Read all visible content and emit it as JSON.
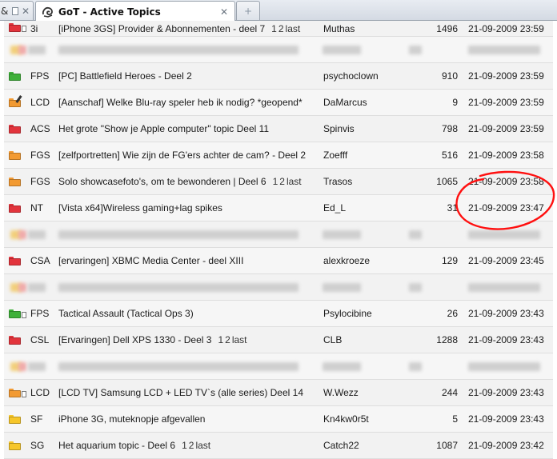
{
  "tabs": {
    "previous": {
      "label": "& "
    },
    "active": {
      "title": "GoT - Active Topics"
    },
    "new_tab_symbol": "+",
    "close_symbol": "✕"
  },
  "colors": {
    "folder_red": "#e2343c",
    "folder_green": "#3fb03a",
    "folder_orange": "#f29a32",
    "folder_yellow": "#f6c62a",
    "annotation_red": "#ff1010"
  },
  "topics": [
    {
      "kind": "topic",
      "icon": "red-folder-doc-icon",
      "color": "red",
      "doc": true,
      "category": "3i",
      "title": "[iPhone 3GS] Provider & Abonnementen - deel 7",
      "pages": [
        "1",
        "2",
        "last"
      ],
      "user": "Muthas",
      "replies": "1496",
      "date": "21-09-2009 23:59"
    },
    {
      "kind": "blurred"
    },
    {
      "kind": "topic",
      "icon": "green-folder-icon",
      "color": "green",
      "category": "FPS",
      "title": "[PC] Battlefield Heroes - Deel 2",
      "pages": [],
      "user": "psychoclown",
      "replies": "910",
      "date": "21-09-2009 23:59"
    },
    {
      "kind": "topic",
      "icon": "orange-folder-pencil-icon",
      "color": "orange",
      "pen": true,
      "category": "LCD",
      "title": "[Aanschaf] Welke Blu-ray speler heb ik nodig? *geopend*",
      "pages": [],
      "user": "DaMarcus",
      "replies": "9",
      "date": "21-09-2009 23:59"
    },
    {
      "kind": "topic",
      "icon": "red-folder-icon",
      "color": "red",
      "category": "ACS",
      "title": "Het grote \"Show je Apple computer\" topic Deel 11",
      "pages": [],
      "user": "Spinvis",
      "replies": "798",
      "date": "21-09-2009 23:59"
    },
    {
      "kind": "topic",
      "icon": "orange-folder-icon",
      "color": "orange",
      "category": "FGS",
      "title": "[zelfportretten] Wie zijn de FG'ers achter de cam? - Deel 2",
      "pages": [],
      "user": "Zoefff",
      "replies": "516",
      "date": "21-09-2009 23:58"
    },
    {
      "kind": "topic",
      "icon": "orange-folder-icon",
      "color": "orange",
      "category": "FGS",
      "title": "Solo showcasefoto's, om te bewonderen | Deel 6",
      "pages": [
        "1",
        "2",
        "last"
      ],
      "user": "Trasos",
      "replies": "1065",
      "date": "21-09-2009 23:58"
    },
    {
      "kind": "topic",
      "icon": "red-folder-icon",
      "color": "red",
      "category": "NT",
      "title": "[Vista x64]Wireless gaming+lag spikes",
      "pages": [],
      "user": "Ed_L",
      "replies": "31",
      "date": "21-09-2009 23:47"
    },
    {
      "kind": "blurred"
    },
    {
      "kind": "topic",
      "icon": "red-folder-icon",
      "color": "red",
      "category": "CSA",
      "title": "[ervaringen] XBMC Media Center - deel XIII",
      "pages": [],
      "user": "alexkroeze",
      "replies": "129",
      "date": "21-09-2009 23:45"
    },
    {
      "kind": "blurred"
    },
    {
      "kind": "topic",
      "icon": "green-folder-doc-icon",
      "color": "green",
      "doc": true,
      "category": "FPS",
      "title": "Tactical Assault (Tactical Ops 3)",
      "pages": [],
      "user": "Psylocibine",
      "replies": "26",
      "date": "21-09-2009 23:43"
    },
    {
      "kind": "topic",
      "icon": "red-folder-icon",
      "color": "red",
      "category": "CSL",
      "title": "[Ervaringen] Dell XPS 1330 - Deel 3",
      "pages": [
        "1",
        "2",
        "last"
      ],
      "user": "CLB",
      "replies": "1288",
      "date": "21-09-2009 23:43"
    },
    {
      "kind": "blurred"
    },
    {
      "kind": "topic",
      "icon": "orange-folder-doc-icon",
      "color": "orange",
      "doc": true,
      "category": "LCD",
      "title": "[LCD TV] Samsung LCD + LED TV`s (alle series) Deel 14",
      "pages": [],
      "user": "W.Wezz",
      "replies": "244",
      "date": "21-09-2009 23:43"
    },
    {
      "kind": "topic",
      "icon": "yellow-folder-icon",
      "color": "yellow",
      "category": "SF",
      "title": "iPhone 3G, muteknopje afgevallen",
      "pages": [],
      "user": "Kn4kw0r5t",
      "replies": "5",
      "date": "21-09-2009 23:43"
    },
    {
      "kind": "topic",
      "icon": "yellow-folder-icon",
      "color": "yellow",
      "category": "SG",
      "title": "Het aquarium topic - Deel 6",
      "pages": [
        "1",
        "2",
        "last"
      ],
      "user": "Catch22",
      "replies": "1087",
      "date": "21-09-2009 23:42"
    }
  ]
}
